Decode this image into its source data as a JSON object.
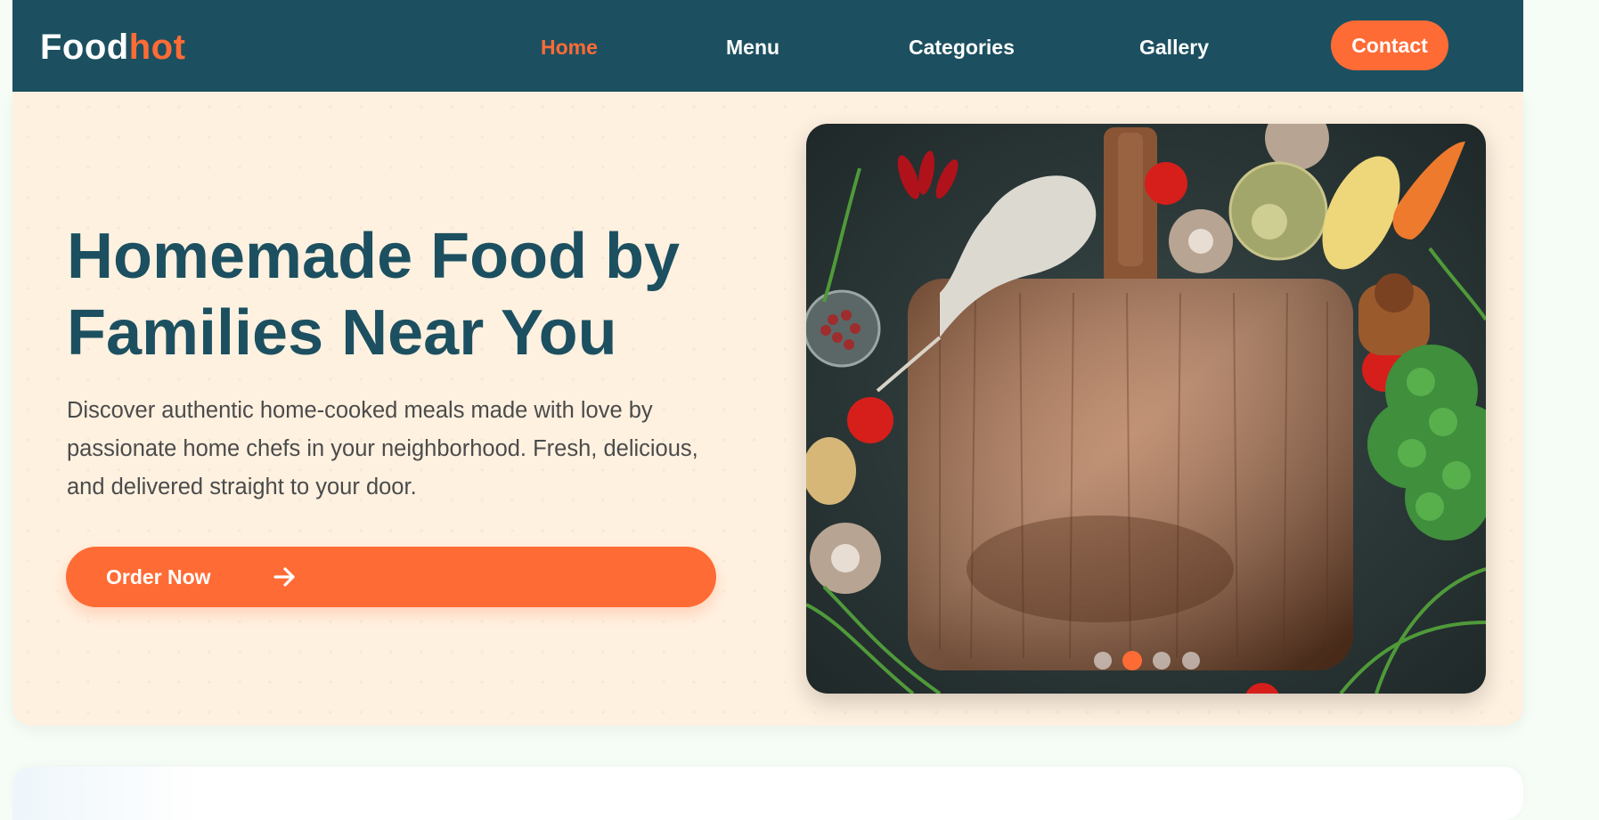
{
  "brand": {
    "part1": "Food",
    "part2": "hot"
  },
  "nav": {
    "home": "Home",
    "menu": "Menu",
    "categories": "Categories",
    "gallery": "Gallery",
    "contact": "Contact",
    "active": "Home"
  },
  "hero": {
    "title": "Homemade Food by Families Near You",
    "description": "Discover authentic home-cooked meals made with love by passionate home chefs in your neighborhood. Fresh, delicious, and delivered straight to your door.",
    "cta_label": "Order Now",
    "cta_icon": "arrow-right-icon",
    "image_subject": "wooden cutting board with vegetables",
    "carousel": {
      "slide_count": 4,
      "active_slide": 2
    }
  },
  "colors": {
    "primary": "#1c5060",
    "accent": "#ff6b35",
    "hero_bg": "#fff1e0",
    "page_bg": "#f6fcf6"
  }
}
